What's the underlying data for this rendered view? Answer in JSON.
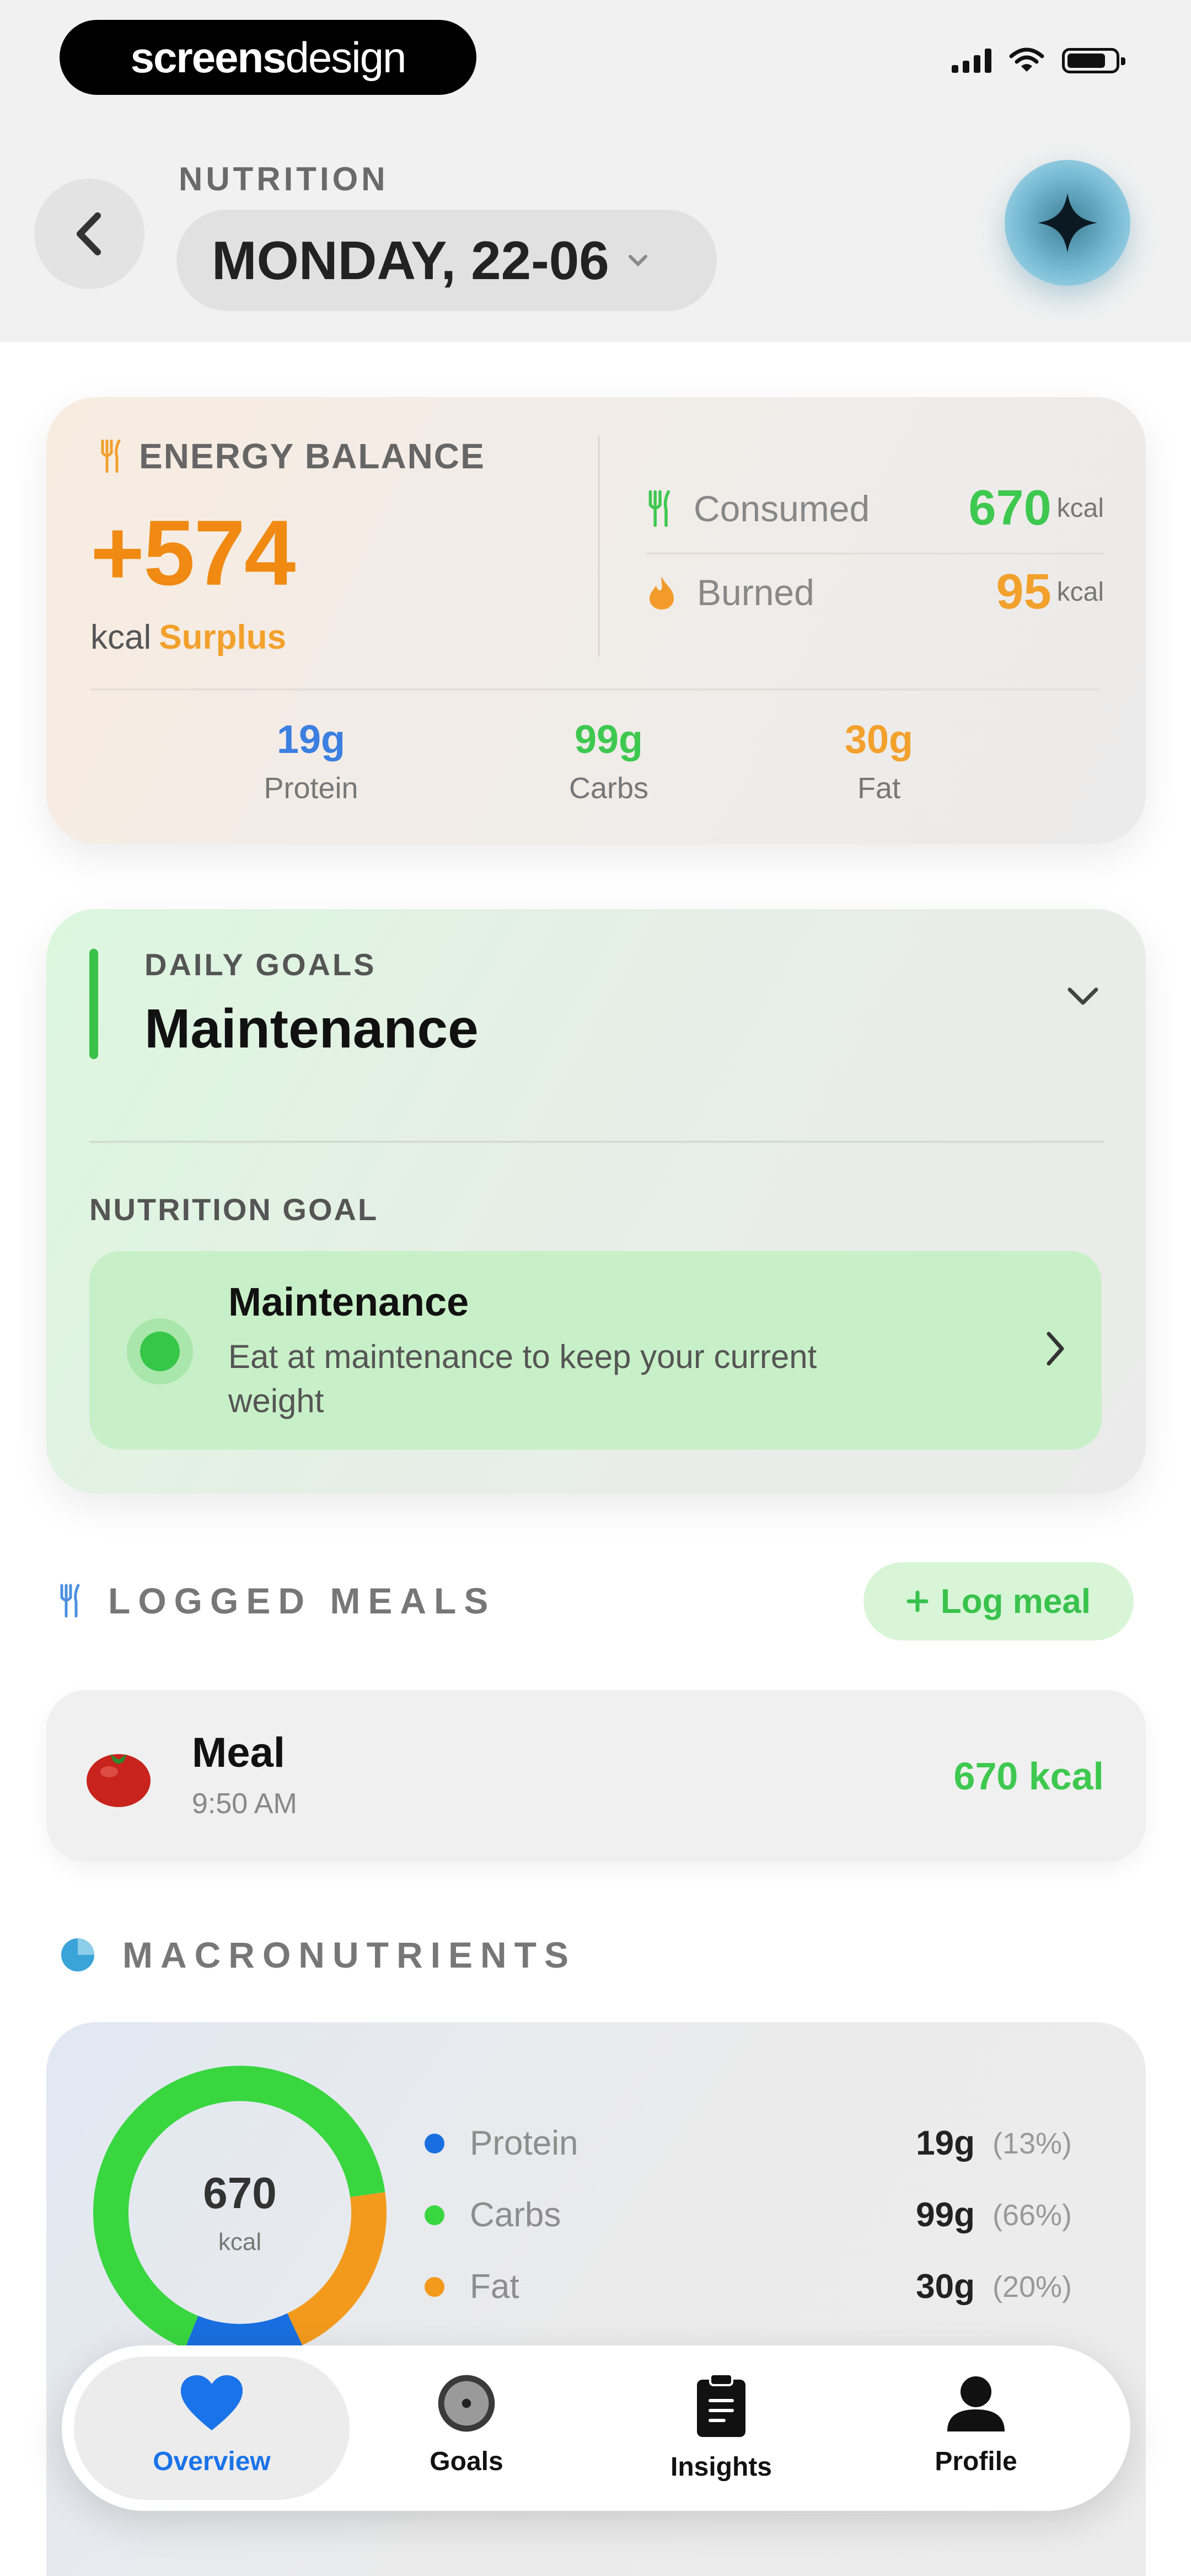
{
  "brand": {
    "bold": "screens",
    "light": "design"
  },
  "header": {
    "eyebrow": "NUTRITION",
    "date": "MONDAY, 22-06"
  },
  "energy": {
    "label": "ENERGY BALANCE",
    "value": "+574",
    "unit": "kcal",
    "status": "Surplus",
    "consumed_label": "Consumed",
    "consumed_value": "670",
    "burned_label": "Burned",
    "burned_value": "95",
    "value_unit": "kcal",
    "macros": [
      {
        "value": "19g",
        "label": "Protein"
      },
      {
        "value": "99g",
        "label": "Carbs"
      },
      {
        "value": "30g",
        "label": "Fat"
      }
    ]
  },
  "goals": {
    "eyebrow": "DAILY GOALS",
    "title": "Maintenance",
    "nutrition_eyebrow": "NUTRITION GOAL",
    "goal_title": "Maintenance",
    "goal_desc": "Eat at maintenance to keep your current weight"
  },
  "meals": {
    "section_title": "LOGGED MEALS",
    "log_button": "Log meal",
    "items": [
      {
        "name": "Meal",
        "time": "9:50 AM",
        "kcal": "670 kcal"
      }
    ]
  },
  "macronutrients": {
    "section_title": "MACRONUTRIENTS",
    "total": "670",
    "unit": "kcal",
    "rows": [
      {
        "name": "Protein",
        "grams": "19g",
        "pct": "(13%)",
        "color": "#1a6fe0",
        "fraction": 0.13
      },
      {
        "name": "Carbs",
        "grams": "99g",
        "pct": "(66%)",
        "color": "#39d640",
        "fraction": 0.66
      },
      {
        "name": "Fat",
        "grams": "30g",
        "pct": "(20%)",
        "color": "#f39a1d",
        "fraction": 0.2
      }
    ]
  },
  "tabs": [
    {
      "label": "Overview",
      "icon": "heart-icon",
      "active": true
    },
    {
      "label": "Goals",
      "icon": "target-icon",
      "active": false
    },
    {
      "label": "Insights",
      "icon": "clipboard-icon",
      "active": false
    },
    {
      "label": "Profile",
      "icon": "person-icon",
      "active": false
    }
  ],
  "colors": {
    "accent_orange": "#f08a12",
    "accent_green": "#3ec84f",
    "accent_blue": "#1a73e8"
  }
}
